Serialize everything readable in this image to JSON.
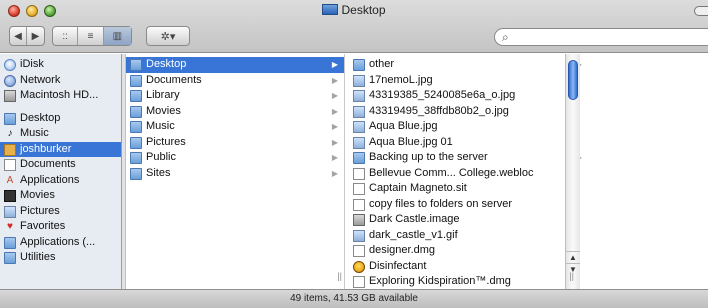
{
  "window": {
    "title": "Desktop"
  },
  "toolbar": {
    "back_icon": "◀",
    "forward_icon": "▶",
    "view_icons": [
      "::",
      "≡",
      "▥"
    ],
    "action_icon": "✲▾",
    "search_placeholder": ""
  },
  "sidebar": {
    "devices": [
      {
        "label": "iDisk",
        "icon": "idisk-icon"
      },
      {
        "label": "Network",
        "icon": "network-icon"
      },
      {
        "label": "Macintosh HD...",
        "icon": "harddisk-icon"
      }
    ],
    "places": [
      {
        "label": "Desktop",
        "icon": "desktop-icon"
      },
      {
        "label": "Music",
        "icon": "music-icon"
      },
      {
        "label": "joshburker",
        "icon": "home-icon",
        "selected": true
      },
      {
        "label": "Documents",
        "icon": "documents-icon"
      },
      {
        "label": "Applications",
        "icon": "applications-icon"
      },
      {
        "label": "Movies",
        "icon": "movies-icon"
      },
      {
        "label": "Pictures",
        "icon": "pictures-icon"
      },
      {
        "label": "Favorites",
        "icon": "favorites-heart-icon"
      },
      {
        "label": "Applications (...",
        "icon": "applications-folder-icon"
      },
      {
        "label": "Utilities",
        "icon": "utilities-folder-icon"
      }
    ]
  },
  "column1": [
    {
      "label": "Desktop",
      "selected": true
    },
    {
      "label": "Documents"
    },
    {
      "label": "Library"
    },
    {
      "label": "Movies"
    },
    {
      "label": "Music"
    },
    {
      "label": "Pictures"
    },
    {
      "label": "Public"
    },
    {
      "label": "Sites"
    }
  ],
  "column2": [
    {
      "label": "other",
      "kind": "folder",
      "has_children": true
    },
    {
      "label": "17nemoL.jpg",
      "kind": "image"
    },
    {
      "label": "43319385_5240085e6a_o.jpg",
      "kind": "image"
    },
    {
      "label": "43319495_38ffdb80b2_o.jpg",
      "kind": "image"
    },
    {
      "label": "Aqua Blue.jpg",
      "kind": "image"
    },
    {
      "label": "Aqua Blue.jpg 01",
      "kind": "image"
    },
    {
      "label": "Backing up to the server",
      "kind": "folder",
      "has_children": true
    },
    {
      "label": "Bellevue Comm... College.webloc",
      "kind": "doc"
    },
    {
      "label": "Captain Magneto.sit",
      "kind": "doc"
    },
    {
      "label": "copy files to folders on server",
      "kind": "doc"
    },
    {
      "label": "Dark Castle.image",
      "kind": "disk"
    },
    {
      "label": "dark_castle_v1.gif",
      "kind": "image"
    },
    {
      "label": "designer.dmg",
      "kind": "doc"
    },
    {
      "label": "Disinfectant",
      "kind": "app"
    },
    {
      "label": "Exploring Kidspiration™.dmg",
      "kind": "doc"
    }
  ],
  "status": {
    "text": "49 items, 41.53 GB available"
  }
}
